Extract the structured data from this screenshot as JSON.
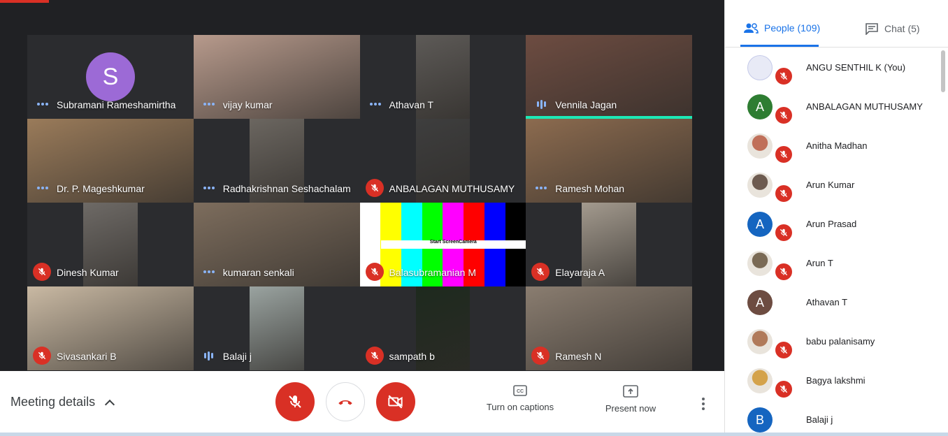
{
  "colors": {
    "accent": "#1a73e8",
    "danger": "#d93025",
    "stage": "#202124",
    "speaking": "#1de9b6"
  },
  "tiles": [
    {
      "name": "Subramani Rameshamirtha",
      "status": "dots",
      "avatar_letter": "S",
      "bg": "#303134"
    },
    {
      "name": "vijay kumar",
      "status": "dots",
      "bg": "#b79a8c"
    },
    {
      "name": "Athavan T",
      "status": "dots",
      "bg": "#5d5a57"
    },
    {
      "name": "Vennila Jagan",
      "status": "speaking",
      "bg": "#6d4c41"
    },
    {
      "name": "Dr. P. Mageshkumar",
      "status": "dots",
      "bg": "#9a7b5a"
    },
    {
      "name": "Radhakrishnan Seshachalam",
      "status": "dots",
      "bg": "#6b6660"
    },
    {
      "name": "ANBALAGAN MUTHUSAMY",
      "status": "muted",
      "bg": "#3e3e3e"
    },
    {
      "name": "Ramesh Mohan",
      "status": "dots",
      "bg": "#8c6b4f"
    },
    {
      "name": "Dinesh Kumar",
      "status": "muted",
      "bg": "#6e6a66"
    },
    {
      "name": "kumaran senkali",
      "status": "dots",
      "bg": "#7d6d5d"
    },
    {
      "name": "Balasubramanian M",
      "status": "muted",
      "bg": "#ffffff",
      "bars": true,
      "bars_text": "Start ScreenCamera"
    },
    {
      "name": "Elayaraja A",
      "status": "muted",
      "bg": "#a39a8e"
    },
    {
      "name": "Sivasankari B",
      "status": "muted",
      "bg": "#c9b9a3"
    },
    {
      "name": "Balaji j",
      "status": "speaking",
      "bg": "#9aa3a0"
    },
    {
      "name": "sampath b",
      "status": "muted",
      "bg": "#1e2a1e"
    },
    {
      "name": "Ramesh N",
      "status": "muted",
      "bg": "#8a7d70"
    }
  ],
  "bottom": {
    "meeting_details": "Meeting details",
    "captions": "Turn on captions",
    "present": "Present now"
  },
  "panel": {
    "people_tab": "People (109)",
    "chat_tab": "Chat (5)",
    "people": [
      {
        "name": "ANGU SENTHIL K (You)",
        "status": "muted",
        "avatar": "logo",
        "color": "#e8eaf6"
      },
      {
        "name": "ANBALAGAN MUTHUSAMY",
        "status": "muted",
        "avatar": "A",
        "color": "#2e7d32"
      },
      {
        "name": "Anitha Madhan",
        "status": "muted",
        "avatar": "photo",
        "color": "#c0705a"
      },
      {
        "name": "Arun Kumar",
        "status": "muted",
        "avatar": "photo",
        "color": "#6d5b50"
      },
      {
        "name": "Arun Prasad",
        "status": "muted",
        "avatar": "A",
        "color": "#1565c0"
      },
      {
        "name": "Arun T",
        "status": "muted",
        "avatar": "photo",
        "color": "#7a6a55"
      },
      {
        "name": "Athavan T",
        "status": "dots",
        "avatar": "A",
        "color": "#6d4c41"
      },
      {
        "name": "babu palanisamy",
        "status": "muted",
        "avatar": "photo",
        "color": "#b07a5a"
      },
      {
        "name": "Bagya lakshmi",
        "status": "muted",
        "avatar": "photo",
        "color": "#d4a24a"
      },
      {
        "name": "Balaji j",
        "status": "speaking",
        "avatar": "B",
        "color": "#1565c0"
      }
    ]
  }
}
